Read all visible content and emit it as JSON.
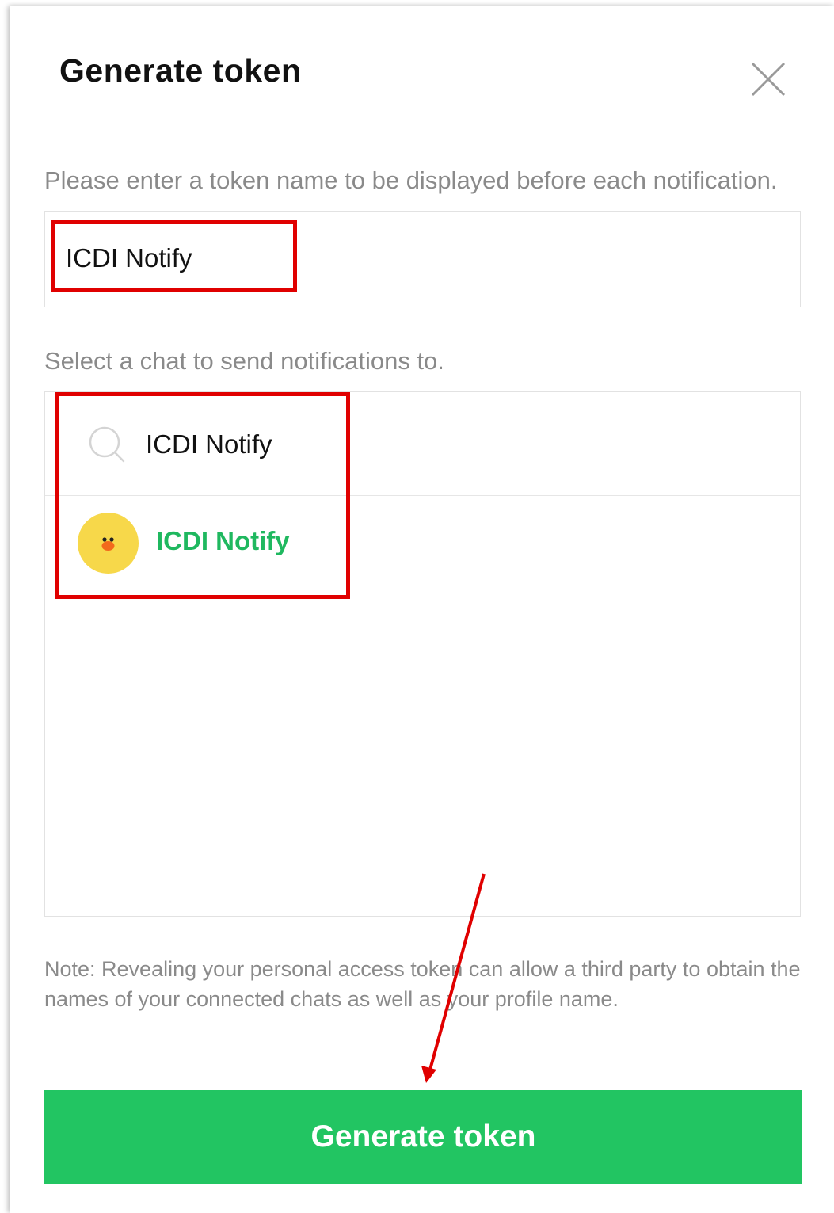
{
  "dialog": {
    "title": "Generate token",
    "close_icon": "close-icon"
  },
  "token_name": {
    "label": "Please enter a token name to be displayed before each notification.",
    "value": "ICDI Notify"
  },
  "chat_select": {
    "label": "Select a chat to send notifications to.",
    "search_icon": "search-icon",
    "search_value": "ICDI Notify",
    "results": [
      {
        "name": "ICDI Notify",
        "avatar": "duck-avatar"
      }
    ]
  },
  "note": "Note: Revealing your personal access token can allow a third party to obtain the names of your connected chats as well as your profile name.",
  "generate_button": {
    "label": "Generate token"
  },
  "colors": {
    "accent_green": "#22c562",
    "selected_text_green": "#1fb85f",
    "highlight_red": "#e00000",
    "avatar_yellow": "#f7d84a"
  }
}
